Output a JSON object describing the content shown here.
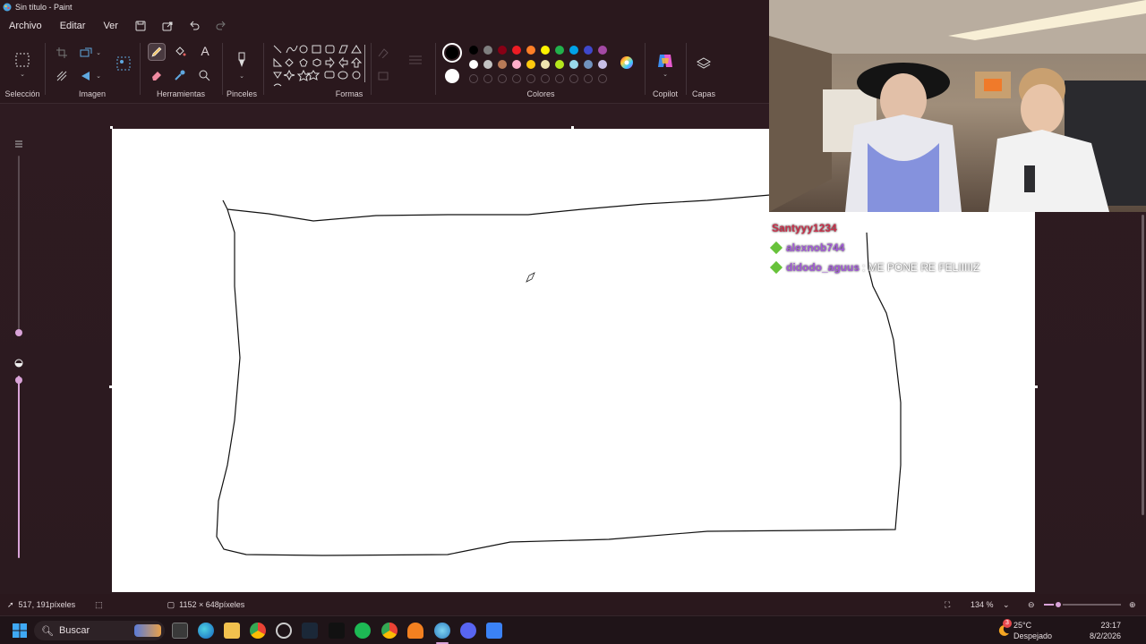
{
  "window": {
    "title": "Sin título - Paint"
  },
  "menu": {
    "items": [
      "Archivo",
      "Editar",
      "Ver"
    ],
    "icons": [
      "save-icon",
      "share-icon",
      "undo-icon",
      "redo-icon"
    ]
  },
  "ribbon": {
    "groups": {
      "seleccion": "Selección",
      "imagen": "Imagen",
      "herramientas": "Herramientas",
      "pinceles": "Pinceles",
      "formas": "Formas",
      "colores": "Colores",
      "copilot": "Copilot",
      "capas": "Capas"
    },
    "text_tool": "A",
    "palette_row1": [
      "#000000",
      "#7f7f7f",
      "#880015",
      "#ed1c24",
      "#ff7f27",
      "#fff200",
      "#22b14c",
      "#00a2e8",
      "#3f48cc",
      "#a349a4"
    ],
    "palette_row2": [
      "#ffffff",
      "#c3c3c3",
      "#b97a57",
      "#ffaec9",
      "#ffc90e",
      "#efe4b0",
      "#b5e61d",
      "#99d9ea",
      "#7092be",
      "#c8bfe7"
    ],
    "primary_color": "#000000",
    "secondary_color": "#ffffff"
  },
  "chat": [
    {
      "user": "Santyyy1234",
      "color": "#c9304a",
      "message": ""
    },
    {
      "user": "alexnob744",
      "color": "#a35bd9",
      "message": ""
    },
    {
      "user": "didodo_aguus",
      "color": "#a35bd9",
      "message": ": ME PONE RE FELIIIIIZ"
    }
  ],
  "status": {
    "cursor_pos": "517, 191píxeles",
    "canvas_size": "1152 × 648píxeles",
    "zoom": "134 %"
  },
  "taskbar": {
    "search_placeholder": "Buscar",
    "weather_temp": "25°C",
    "weather_desc": "Despejado",
    "time": "23:17",
    "date": "8/2/2026",
    "notification_count": "3"
  }
}
